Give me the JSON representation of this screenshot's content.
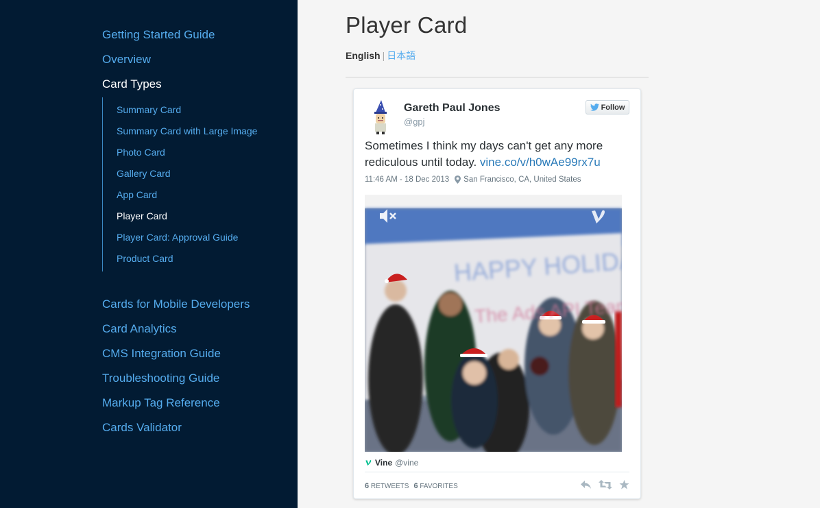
{
  "sidebar": {
    "top_items": [
      {
        "label": "Getting Started Guide"
      },
      {
        "label": "Overview"
      },
      {
        "label": "Card Types"
      }
    ],
    "sub_items": [
      {
        "label": "Summary Card"
      },
      {
        "label": "Summary Card with Large Image"
      },
      {
        "label": "Photo Card"
      },
      {
        "label": "Gallery Card"
      },
      {
        "label": "App Card"
      },
      {
        "label": "Player Card"
      },
      {
        "label": "Player Card: Approval Guide"
      },
      {
        "label": "Product Card"
      }
    ],
    "bottom_items": [
      {
        "label": "Cards for Mobile Developers"
      },
      {
        "label": "Card Analytics"
      },
      {
        "label": "CMS Integration Guide"
      },
      {
        "label": "Troubleshooting Guide"
      },
      {
        "label": "Markup Tag Reference"
      },
      {
        "label": "Cards Validator"
      }
    ]
  },
  "page": {
    "title": "Player Card",
    "lang_english": "English",
    "lang_separator": "|",
    "lang_japanese": "日本語"
  },
  "tweet": {
    "author_name": "Gareth Paul Jones",
    "author_handle": "@gpj",
    "follow_label": "Follow",
    "text": "Sometimes I think my days can't get any more rediculous until today. ",
    "link": "vine.co/v/h0wAe99rx7u",
    "timestamp": "11:46 AM - 18 Dec 2013",
    "location": "San Francisco, CA, United States",
    "video_banner_line1": "HAPPY HOLIDAY",
    "video_banner_line2": "The Ads API Team",
    "source_name": "Vine",
    "source_handle": "@vine",
    "retweets_count": "6",
    "retweets_label": "RETWEETS",
    "favorites_count": "6",
    "favorites_label": "FAVORITES"
  },
  "colors": {
    "sidebar_bg": "#021b33",
    "link": "#55acee",
    "vine_green": "#00bf8f"
  }
}
